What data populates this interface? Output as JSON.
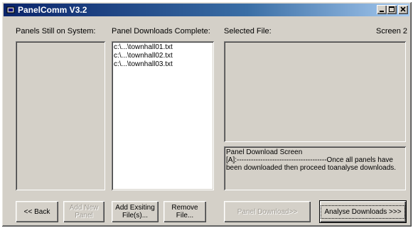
{
  "window": {
    "title": "PanelComm V3.2",
    "icon": "app-icon",
    "controls": [
      "minimize-icon",
      "maximize-icon",
      "close-icon"
    ]
  },
  "labels": {
    "panels_on_system": "Panels Still on System:",
    "downloads_complete": "Panel Downloads Complete:",
    "selected_file": "Selected File:",
    "screen": "Screen 2"
  },
  "downloads_list": [
    "c:\\...\\townhall01.txt",
    "c:\\...\\townhall02.txt",
    "c:\\...\\townhall03.txt"
  ],
  "status": {
    "heading": "Panel Download Screen",
    "line1": "[A]:--------------------------------------Once all panels have",
    "line2": "been downloaded then proceed toanalyse downloads."
  },
  "buttons": {
    "back": "<< Back",
    "add_new_line1": "Add New",
    "add_new_line2": "Panel",
    "add_existing_line1": "Add Exsiting",
    "add_existing_line2": "File(s)...",
    "remove_line1": "Remove",
    "remove_line2": "File...",
    "panel_download": "Panel Download>>",
    "analyse": "Analyse Downloads >>>"
  }
}
